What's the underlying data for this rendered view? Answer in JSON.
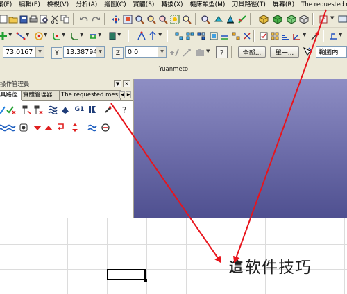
{
  "menu": {
    "items": [
      "案(F)",
      "編輯(E)",
      "檢視(V)",
      "分析(A)",
      "繪圖(C)",
      "實體(S)",
      "轉換(X)",
      "機床類型(M)",
      "刀具路徑(T)",
      "屏幕(R)",
      "The requested messa"
    ]
  },
  "coords": {
    "x_value": "73.0167",
    "y_label": "Y",
    "y_value": "13.38794",
    "z_label": "Z",
    "z_value": "0.0"
  },
  "toolbar3": {
    "all_button": "全部...",
    "single_button": "單一...",
    "range_value": "範圍內"
  },
  "viewport": {
    "title": "Yuanmeto"
  },
  "panel": {
    "title": "操作管理員",
    "tabs": [
      "具路徑",
      "實體管理器",
      "The requested messa"
    ],
    "g1_label": "G1"
  },
  "watermark": {
    "logo": "這",
    "text": "软件技巧"
  },
  "colors": {
    "annotation_arrow": "#e8141c",
    "viewport_top": "#8e8ec4",
    "viewport_bottom": "#4f5090",
    "chrome": "#ece9d8"
  }
}
